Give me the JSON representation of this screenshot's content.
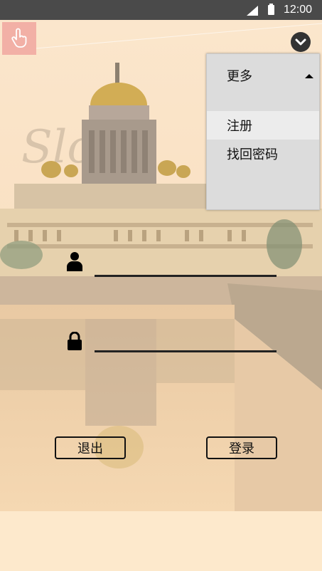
{
  "status_bar": {
    "time": "12:00"
  },
  "menu": {
    "header_label": "更多",
    "items": [
      {
        "label": "注册"
      },
      {
        "label": "找回密码"
      }
    ]
  },
  "buttons": {
    "exit_label": "退出",
    "login_label": "登录"
  },
  "fields": {
    "username_value": "",
    "password_value": ""
  },
  "icons": {
    "touch": "touch-icon",
    "chevron": "chevron-down-icon",
    "user": "user-icon",
    "lock": "lock-icon",
    "caret": "caret-up-icon"
  }
}
